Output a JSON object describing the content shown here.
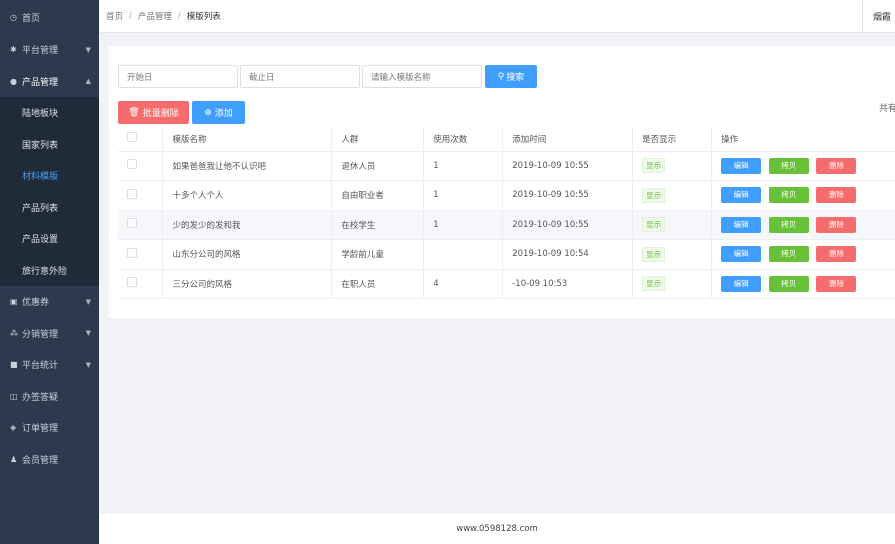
{
  "sidebar": {
    "items": [
      {
        "label": "首页",
        "icon": "dashboard-icon"
      },
      {
        "label": "平台管理",
        "icon": "gear-icon"
      },
      {
        "label": "产品管理",
        "icon": "globe-icon"
      },
      {
        "label": "优惠券",
        "icon": "coupon-icon"
      },
      {
        "label": "分销管理",
        "icon": "network-icon"
      },
      {
        "label": "平台统计",
        "icon": "chat-icon"
      },
      {
        "label": "办签答疑",
        "icon": "book-icon"
      },
      {
        "label": "订单管理",
        "icon": "layers-icon"
      },
      {
        "label": "会员管理",
        "icon": "user-icon"
      }
    ],
    "sub_items": [
      "陆地板块",
      "国家列表",
      "材料模版",
      "产品列表",
      "产品设置",
      "旅行意外险"
    ]
  },
  "breadcrumb": {
    "home": "首页",
    "section": "产品管理",
    "page": "模版列表",
    "sep": "/"
  },
  "topbar": {
    "right_tab": "烟霞"
  },
  "filters": {
    "start_placeholder": "开始日",
    "end_placeholder": "截止日",
    "name_placeholder": "请输入模版名称",
    "search_label": "搜索"
  },
  "actions": {
    "batch_delete": "批量删除",
    "add": "添加"
  },
  "total_text": "共有",
  "table": {
    "headers": [
      "模版名称",
      "人群",
      "使用次数",
      "添加时间",
      "是否显示",
      "操作"
    ],
    "rows": [
      {
        "name": "如果爸爸我让他不认识吧",
        "group": "退休人员",
        "count": "1",
        "time": "2019-10-09 10:55",
        "show": "显示"
      },
      {
        "name": "十多个人个人",
        "group": "自由职业者",
        "count": "1",
        "time": "2019-10-09 10:55",
        "show": "显示"
      },
      {
        "name": "少的发少的发和我",
        "group": "在校学生",
        "count": "1",
        "time": "2019-10-09 10:55",
        "show": "显示"
      },
      {
        "name": "山东分公司的风格",
        "group": "学龄前儿童",
        "count": "",
        "time": "2019-10-09 10:54",
        "show": "显示"
      },
      {
        "name": "三分公司的风格",
        "group": "在职人员",
        "count": "4",
        "time": "-10-09 10:53",
        "show": "显示"
      }
    ],
    "ops": {
      "edit": "编辑",
      "copy": "拷贝",
      "delete": "删除"
    }
  },
  "footer": {
    "text": "www.0598128.com"
  }
}
